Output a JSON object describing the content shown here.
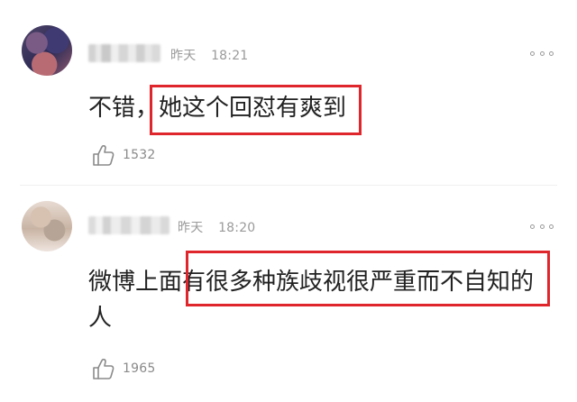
{
  "comments": [
    {
      "date_label": "昨天",
      "time": "18:21",
      "text_prefix": "不错，",
      "text_highlight": "她这个回怼有爽到",
      "likes": "1532"
    },
    {
      "date_label": "昨天",
      "time": "18:20",
      "text_line1_prefix": "微博上面",
      "text_line1_highlight": "有很多种族歧视很严重而不自知的",
      "text_line2": "人",
      "likes": "1965"
    }
  ],
  "colors": {
    "highlight_border": "#e0262d",
    "meta_text": "#9a9a9a",
    "body_text": "#222222"
  },
  "icons": {
    "more": "more-dots-icon",
    "like": "thumbs-up-icon"
  }
}
